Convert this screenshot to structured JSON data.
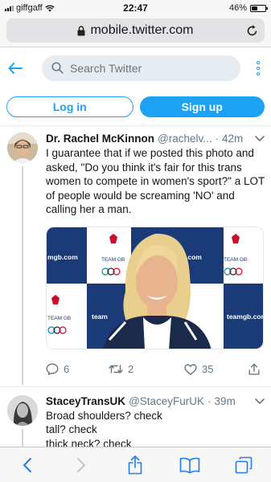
{
  "status_bar": {
    "carrier": "giffgaff",
    "time": "22:47",
    "battery": "46%",
    "battery_level": 0.46
  },
  "browser": {
    "url": "mobile.twitter.com"
  },
  "header": {
    "search_placeholder": "Search Twitter",
    "login_label": "Log in",
    "signup_label": "Sign up"
  },
  "tweets": [
    {
      "name": "Dr. Rachel McKinnon",
      "handle": "@rachelv...",
      "time": "42m",
      "text": "I guarantee that if we posted this photo and asked, \"Do you think it's fair for this trans women to compete in women's sport?\" a LOT of people would be screaming 'NO' and calling her a man.",
      "media_texts": {
        "brand_left": "mgb.com",
        "brand_mid": ".com",
        "brand_right": "teamgb.com",
        "team_gb": "TEAM GB",
        "team_short": "team"
      },
      "replies": "6",
      "retweets": "2",
      "likes": "35"
    },
    {
      "name": "StaceyTransUK",
      "handle": "@StaceyFurUK",
      "time": "39m",
      "text": "Broad shoulders? check\ntall? check\nthick neck? check\nlarge head? check\nProminent jaw? check"
    }
  ],
  "colors": {
    "accent": "#1da1f2",
    "muted": "#657786",
    "text": "#14171a"
  }
}
